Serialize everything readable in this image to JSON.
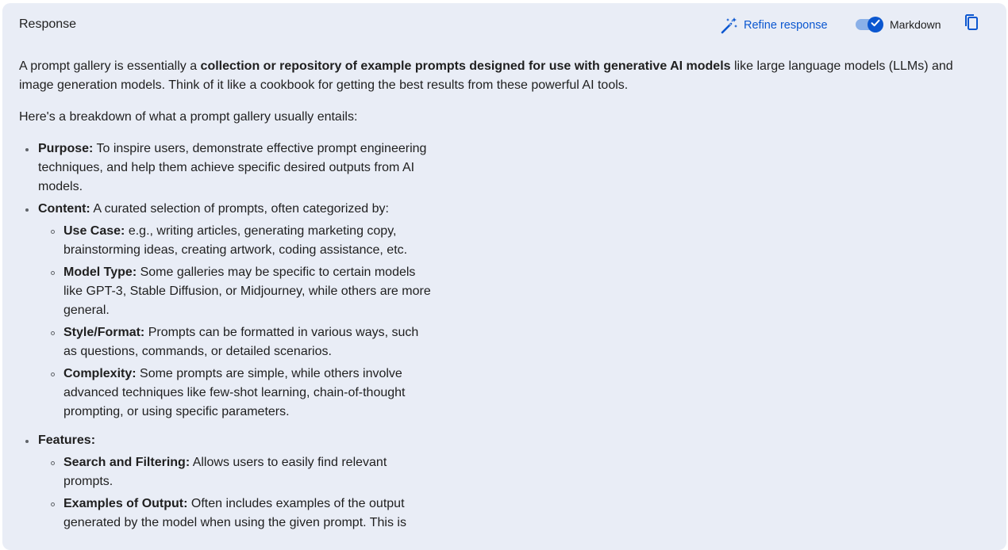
{
  "header": {
    "title": "Response",
    "refine_label": "Refine response",
    "markdown_label": "Markdown",
    "markdown_enabled": true,
    "icons": {
      "refine": "magic-wand-icon",
      "toggle_check": "check-icon",
      "copy": "copy-icon"
    },
    "colors": {
      "accent": "#0b57d0",
      "panel_bg": "#e9edf6",
      "text": "#1f1f1f"
    }
  },
  "content": {
    "intro": {
      "before": "A prompt gallery is essentially a ",
      "bold": "collection or repository of example prompts designed for use with generative AI models",
      "after": " like large language models (LLMs) and image generation models. Think of it like a cookbook for getting the best results from these powerful AI tools."
    },
    "breakdown": "Here's a breakdown of what a prompt gallery usually entails:",
    "items": [
      {
        "label": "Purpose:",
        "text": " To inspire users, demonstrate effective prompt engineering techniques, and help them achieve specific desired outputs from AI models."
      },
      {
        "label": "Content:",
        "text": " A curated selection of prompts, often categorized by:",
        "subitems": [
          {
            "label": "Use Case:",
            "text": " e.g., writing articles, generating marketing copy, brainstorming ideas, creating artwork, coding assistance, etc."
          },
          {
            "label": "Model Type:",
            "text": " Some galleries may be specific to certain models like GPT-3, Stable Diffusion, or Midjourney, while others are more general."
          },
          {
            "label": "Style/Format:",
            "text": " Prompts can be formatted in various ways, such as questions, commands, or detailed scenarios."
          },
          {
            "label": "Complexity:",
            "text": " Some prompts are simple, while others involve advanced techniques like few-shot learning, chain-of-thought prompting, or using specific parameters."
          }
        ]
      },
      {
        "label": "Features:",
        "text": "",
        "subitems": [
          {
            "label": "Search and Filtering:",
            "text": " Allows users to easily find relevant prompts."
          },
          {
            "label": "Examples of Output:",
            "text": " Often includes examples of the output generated by the model when using the given prompt. This is"
          }
        ]
      }
    ]
  }
}
